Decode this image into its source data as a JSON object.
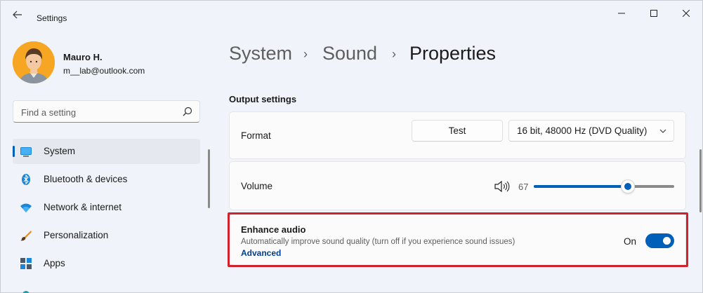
{
  "window": {
    "title": "Settings"
  },
  "user": {
    "name": "Mauro H.",
    "email": "m__lab@outlook.com"
  },
  "search": {
    "placeholder": "Find a setting"
  },
  "sidebar": {
    "items": [
      {
        "label": "System",
        "icon": "monitor-icon",
        "active": true
      },
      {
        "label": "Bluetooth & devices",
        "icon": "bluetooth-icon"
      },
      {
        "label": "Network & internet",
        "icon": "wifi-icon"
      },
      {
        "label": "Personalization",
        "icon": "brush-icon"
      },
      {
        "label": "Apps",
        "icon": "apps-icon"
      }
    ]
  },
  "breadcrumb": {
    "items": [
      "System",
      "Sound",
      "Properties"
    ],
    "separator": "›"
  },
  "section": {
    "title": "Output settings"
  },
  "format": {
    "label": "Format",
    "test_label": "Test",
    "value": "16 bit, 48000 Hz (DVD Quality)"
  },
  "volume": {
    "label": "Volume",
    "value": "67",
    "level": 67
  },
  "enhance": {
    "title": "Enhance audio",
    "description": "Automatically improve sound quality (turn off if you experience sound issues)",
    "link": "Advanced",
    "toggle_label": "On",
    "enabled": true
  },
  "colors": {
    "accent": "#005fb8",
    "highlight_border": "#d0222d",
    "link": "#003e92"
  }
}
